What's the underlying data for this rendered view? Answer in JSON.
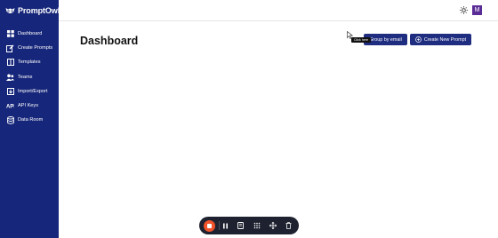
{
  "app": {
    "name": "PromptOwl"
  },
  "sidebar": {
    "items": [
      {
        "label": "Dashboard",
        "icon": "grid-icon"
      },
      {
        "label": "Create Prompts",
        "icon": "edit-icon"
      },
      {
        "label": "Templates",
        "icon": "columns-icon"
      },
      {
        "label": "Teams",
        "icon": "users-icon"
      },
      {
        "label": "Import/Export",
        "icon": "import-icon"
      },
      {
        "label": "API Keys",
        "icon": "key-icon"
      },
      {
        "label": "Data Room",
        "icon": "database-icon"
      }
    ]
  },
  "header": {
    "avatar_initial": "M"
  },
  "main": {
    "title": "Dashboard",
    "group_button_label": "Group by email",
    "create_button_label": "Create New Prompt",
    "tooltip_text": "Click here"
  },
  "colors": {
    "sidebar": "#16267a",
    "primary_button": "#1f2d80",
    "avatar": "#5a2c96",
    "record_button": "#f0532b",
    "recorder_bar": "#1e2230"
  }
}
